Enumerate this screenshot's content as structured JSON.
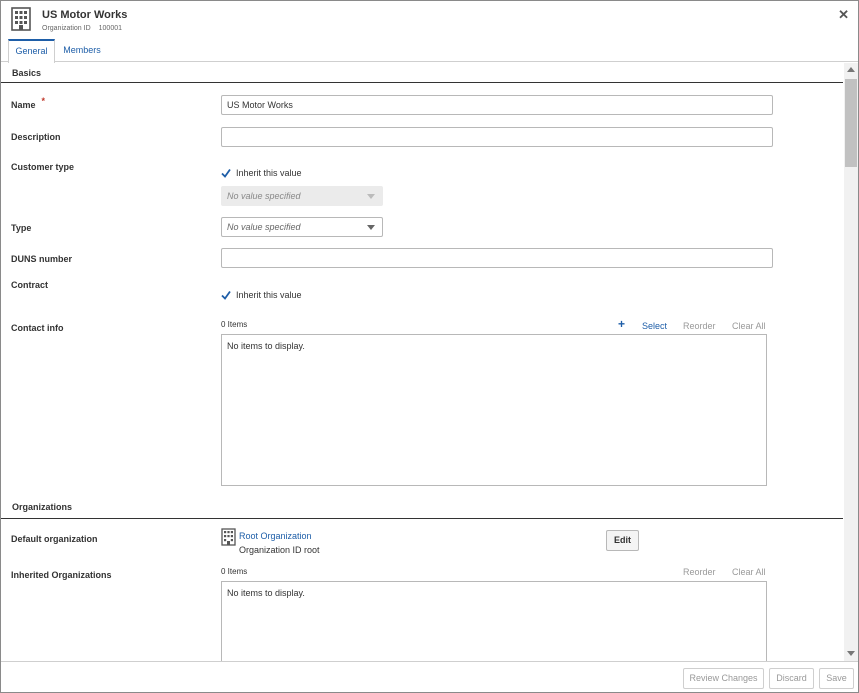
{
  "header": {
    "title": "US Motor Works",
    "subtitle_label": "Organization ID",
    "subtitle_value": "100001",
    "close_glyph": "✕"
  },
  "tabs": [
    {
      "label": "General",
      "active": true
    },
    {
      "label": "Members",
      "active": false
    }
  ],
  "basics": {
    "heading": "Basics",
    "name_label": "Name",
    "name_required": "*",
    "name_value": "US Motor Works",
    "description_label": "Description",
    "description_value": "",
    "customer_type_label": "Customer type",
    "customer_type_inherit_label": "Inherit this value",
    "customer_type_inherit_checked": true,
    "customer_type_value": "No value specified",
    "type_label": "Type",
    "type_value": "No value specified",
    "duns_label": "DUNS number",
    "duns_value": "",
    "contract_label": "Contract",
    "contract_inherit_label": "Inherit this value",
    "contract_inherit_checked": true,
    "contact_info_label": "Contact info",
    "contact_info_count": "0 Items",
    "contact_info_select": "Select",
    "contact_info_reorder": "Reorder",
    "contact_info_clear": "Clear All",
    "contact_info_empty": "No items to display."
  },
  "organizations": {
    "heading": "Organizations",
    "default_label": "Default organization",
    "default_org_name": "Root Organization",
    "default_org_id": "Organization ID root",
    "edit_label": "Edit",
    "inherited_label": "Inherited Organizations",
    "inherited_count": "0 Items",
    "inherited_reorder": "Reorder",
    "inherited_clear": "Clear All",
    "inherited_empty": "No items to display."
  },
  "footer": {
    "review_label": "Review Changes",
    "discard_label": "Discard",
    "save_label": "Save"
  },
  "colors": {
    "accent": "#1e5ea8",
    "required": "#c0392b",
    "border": "#b8b8b8"
  },
  "icons": {
    "header": "building-icon",
    "close": "close-icon",
    "checkbox": "checkmark-icon",
    "dropdown": "chevron-down-icon",
    "add": "plus-icon",
    "org": "building-icon"
  }
}
